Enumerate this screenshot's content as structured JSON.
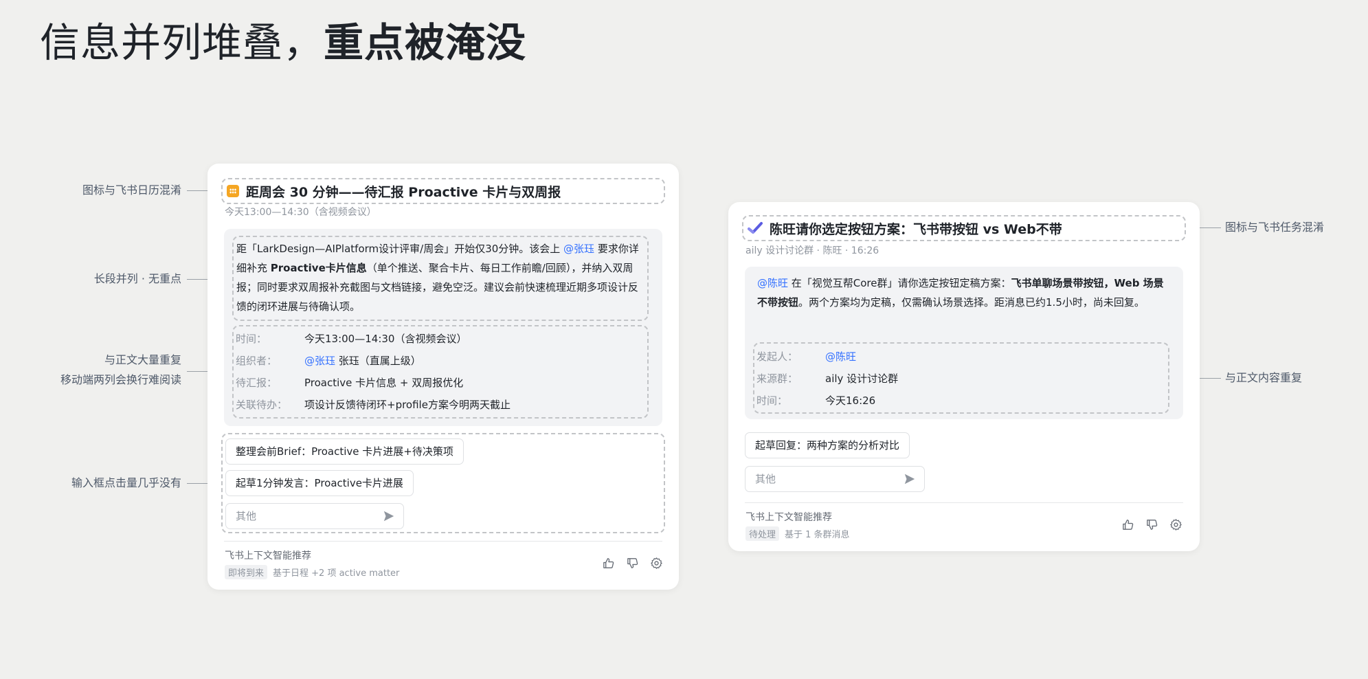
{
  "page": {
    "title_normal": "信息并列堆叠，",
    "title_bold": "重点被淹没"
  },
  "annotations": {
    "left": [
      {
        "text": "图标与飞书日历混淆"
      },
      {
        "text": "长段并列 · 无重点"
      },
      {
        "text_line1": "与正文大量重复",
        "text_line2": "移动端两列会换行难阅读"
      },
      {
        "text": "输入框点击量几乎没有"
      }
    ],
    "right": [
      {
        "text": "图标与飞书任务混淆"
      },
      {
        "text": "与正文内容重复"
      }
    ]
  },
  "left_card": {
    "icon": "calendar-icon",
    "title": "距周会 30 分钟——待汇报 Proactive 卡片与双周报",
    "subtitle": "今天13:00—14:30（含视频会议）",
    "body": {
      "p1": "距「LarkDesign—AIPlatform设计评审/周会」开始仅30分钟。该会上 ",
      "mention": "@张珏",
      "p2": " 要求你详细补充 ",
      "bold": "Proactive卡片信息",
      "p3": "（单个推送、聚合卡片、每日工作前瞻/回顾），并纳入双周报；同时要求双周报补充截图与文档链接，避免空泛。建议会前快速梳理近期多项设计反馈的闭环进展与待确认项。"
    },
    "info": [
      {
        "label": "时间：",
        "value": "今天13:00—14:30（含视频会议）"
      },
      {
        "label": "组织者：",
        "mention": "@张珏",
        "value": " 张珏（直属上级）"
      },
      {
        "label": "待汇报：",
        "value": "Proactive 卡片信息 + 双周报优化"
      },
      {
        "label": "关联待办：",
        "value": "项设计反馈待闭环+profile方案今明两天截止"
      }
    ],
    "chips": [
      "整理会前Brief：Proactive 卡片进展+待决策项",
      "起草1分钟发言：Proactive卡片进展"
    ],
    "input_placeholder": "其他",
    "footer": {
      "title": "飞书上下文智能推荐",
      "tag": "即将到来",
      "meta": "基于日程 +2 项 active matter"
    }
  },
  "right_card": {
    "icon": "task-check-icon",
    "title": "陈旺请你选定按钮方案：飞书带按钮 vs Web不带",
    "subtitle": "aily 设计讨论群 · 陈旺 · 16:26",
    "body": {
      "mention": "@陈旺",
      "p1": " 在「视觉互帮Core群」请你选定按钮定稿方案：",
      "bold": "飞书单聊场景带按钮，Web 场景不带按钮",
      "p2": "。两个方案均为定稿，仅需确认场景选择。距消息已约1.5小时，尚未回复。"
    },
    "info": [
      {
        "label": "发起人：",
        "mention": "@陈旺",
        "value": ""
      },
      {
        "label": "来源群：",
        "value": "aily 设计讨论群"
      },
      {
        "label": "时间：",
        "value": "今天16:26"
      }
    ],
    "chips": [
      "起草回复：两种方案的分析对比"
    ],
    "input_placeholder": "其他",
    "footer": {
      "title": "飞书上下文智能推荐",
      "tag": "待处理",
      "meta": "基于 1 条群消息"
    }
  },
  "colors": {
    "background": "#f0f0ee",
    "mention": "#3370ff",
    "calendar_icon": "#f5a623",
    "task_icon": "#5b5ce2"
  }
}
